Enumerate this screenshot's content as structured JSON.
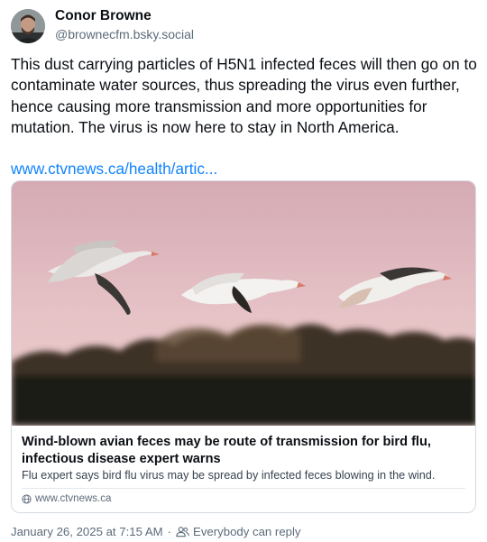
{
  "author": {
    "name": "Conor Browne",
    "handle": "@brownecfm.bsky.social"
  },
  "post": {
    "text": "This dust carrying particles of H5N1 infected feces will then go on to contaminate water sources, thus spreading the virus even further, hence causing more transmission and more opportunities for mutation. The virus is now here to stay in North America.",
    "link_text": "www.ctvnews.ca/health/artic...",
    "link_color": "#1083fe"
  },
  "link_card": {
    "title": "Wind-blown avian feces may be route of transmission for bird flu, infectious disease expert warns",
    "description": "Flu expert says bird flu virus may be spread by infected feces blowing in the wind.",
    "source": "www.ctvnews.ca",
    "source_icon": "globe-icon"
  },
  "footer": {
    "timestamp": "January 26, 2025 at 7:15 AM",
    "separator": "·",
    "reply_setting": "Everybody can reply",
    "reply_icon": "people-icon"
  }
}
